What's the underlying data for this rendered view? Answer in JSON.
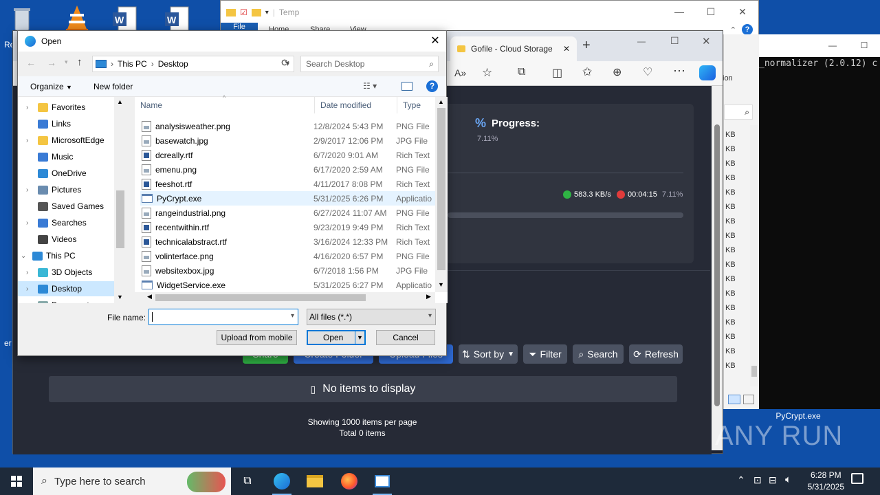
{
  "desktop": {
    "recycle_label": "Re",
    "pycrypt_label": "PyCrypt.exe",
    "left_labels": [
      "er"
    ]
  },
  "explorer": {
    "title": "Temp",
    "tabs": [
      "File",
      "Home",
      "Share",
      "View"
    ]
  },
  "cmd": {
    "text": "_normalizer (2.0.12) c"
  },
  "right_panel": {
    "sizes": [
      "KB",
      "KB",
      "KB",
      "KB",
      "KB",
      "KB",
      "KB",
      "KB",
      "KB",
      "KB",
      "KB",
      "KB",
      "KB",
      "KB",
      "KB",
      "KB",
      "KB"
    ],
    "ion": "ion"
  },
  "edge": {
    "tab_title": "Gofile - Cloud Storage",
    "progress": {
      "title": "Progress:",
      "value": "7.11%",
      "speed": "583.3 KB/s",
      "eta": "00:04:15",
      "pct": "7.11%"
    },
    "buttons": {
      "share": "Share",
      "create_folder": "Create Folder",
      "upload": "Upload Files",
      "sort": "Sort by",
      "filter": "Filter",
      "search": "Search",
      "refresh": "Refresh"
    },
    "empty": "No items to display",
    "footer1": "Showing 1000 items per page",
    "footer2": "Total 0 items"
  },
  "dialog": {
    "title": "Open",
    "breadcrumb": [
      "This PC",
      "Desktop"
    ],
    "search_placeholder": "Search Desktop",
    "organize": "Organize",
    "new_folder": "New folder",
    "nav": [
      {
        "label": "Favorites",
        "icon": "star-icon"
      },
      {
        "label": "Links",
        "icon": "links-icon"
      },
      {
        "label": "MicrosoftEdge",
        "icon": "folder-icon"
      },
      {
        "label": "Music",
        "icon": "music-icon"
      },
      {
        "label": "OneDrive",
        "icon": "cloud-icon"
      },
      {
        "label": "Pictures",
        "icon": "pictures-icon"
      },
      {
        "label": "Saved Games",
        "icon": "games-icon"
      },
      {
        "label": "Searches",
        "icon": "search-icon"
      },
      {
        "label": "Videos",
        "icon": "videos-icon"
      },
      {
        "label": "This PC",
        "icon": "pc-icon"
      },
      {
        "label": "3D Objects",
        "icon": "cube-icon"
      },
      {
        "label": "Desktop",
        "icon": "desktop-icon"
      },
      {
        "label": "Documents",
        "icon": "documents-icon"
      }
    ],
    "columns": {
      "name": "Name",
      "date": "Date modified",
      "type": "Type"
    },
    "files": [
      {
        "name": "analysisweather.png",
        "date": "12/8/2024 5:43 PM",
        "type": "PNG File",
        "kind": "img"
      },
      {
        "name": "basewatch.jpg",
        "date": "2/9/2017 12:06 PM",
        "type": "JPG File",
        "kind": "img"
      },
      {
        "name": "dcreally.rtf",
        "date": "6/7/2020 9:01 AM",
        "type": "Rich Text",
        "kind": "rtf"
      },
      {
        "name": "emenu.png",
        "date": "6/17/2020 2:59 AM",
        "type": "PNG File",
        "kind": "img"
      },
      {
        "name": "feeshot.rtf",
        "date": "4/11/2017 8:08 PM",
        "type": "Rich Text",
        "kind": "rtf"
      },
      {
        "name": "PyCrypt.exe",
        "date": "5/31/2025 6:26 PM",
        "type": "Applicatio",
        "kind": "exe"
      },
      {
        "name": "rangeindustrial.png",
        "date": "6/27/2024 11:07 AM",
        "type": "PNG File",
        "kind": "img"
      },
      {
        "name": "recentwithin.rtf",
        "date": "9/23/2019 9:49 PM",
        "type": "Rich Text",
        "kind": "rtf"
      },
      {
        "name": "technicalabstract.rtf",
        "date": "3/16/2024 12:33 PM",
        "type": "Rich Text",
        "kind": "rtf"
      },
      {
        "name": "volinterface.png",
        "date": "4/16/2020 6:57 PM",
        "type": "PNG File",
        "kind": "img"
      },
      {
        "name": "websitexbox.jpg",
        "date": "6/7/2018 1:56 PM",
        "type": "JPG File",
        "kind": "img"
      },
      {
        "name": "WidgetService.exe",
        "date": "5/31/2025 6:27 PM",
        "type": "Applicatio",
        "kind": "exe"
      }
    ],
    "filename_label": "File name:",
    "filename_value": "",
    "filter_value": "All files (*.*)",
    "upload_mobile": "Upload from mobile",
    "open": "Open",
    "cancel": "Cancel"
  },
  "taskbar": {
    "search_placeholder": "Type here to search",
    "time": "6:28 PM",
    "date": "5/31/2025"
  },
  "watermark": "ANY RUN"
}
